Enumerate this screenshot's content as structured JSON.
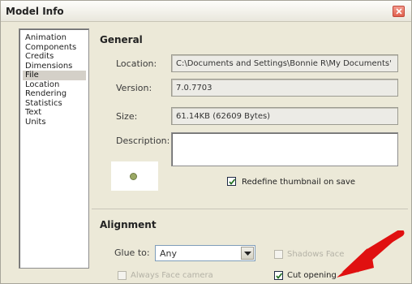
{
  "window": {
    "title": "Model Info"
  },
  "sidebar": {
    "items": [
      {
        "label": "Animation"
      },
      {
        "label": "Components"
      },
      {
        "label": "Credits"
      },
      {
        "label": "Dimensions"
      },
      {
        "label": "File",
        "selected": true
      },
      {
        "label": "Location"
      },
      {
        "label": "Rendering"
      },
      {
        "label": "Statistics"
      },
      {
        "label": "Text"
      },
      {
        "label": "Units"
      }
    ]
  },
  "general": {
    "title": "General",
    "location_label": "Location:",
    "location_value": "C:\\Documents and Settings\\Bonnie R\\My Documents'",
    "version_label": "Version:",
    "version_value": "7.0.7703",
    "size_label": "Size:",
    "size_value": "61.14KB (62609 Bytes)",
    "description_label": "Description:",
    "description_value": "",
    "redefine_thumbnail_label": "Redefine thumbnail on save",
    "redefine_thumbnail_checked": true
  },
  "alignment": {
    "title": "Alignment",
    "glue_to_label": "Glue to:",
    "glue_to_value": "Any",
    "shadows_face_label": "Shadows Face",
    "shadows_face_checked": false,
    "always_face_camera_label": "Always Face camera",
    "always_face_camera_checked": false,
    "cut_opening_label": "Cut opening",
    "cut_opening_checked": true
  },
  "colors": {
    "dialog_bg": "#ece9d8",
    "annotation_arrow": "#e01010",
    "close_button": "#e0604d"
  },
  "icons": {
    "close": "close-icon",
    "dropdown": "chevron-down-icon",
    "annotation": "arrow-icon"
  }
}
